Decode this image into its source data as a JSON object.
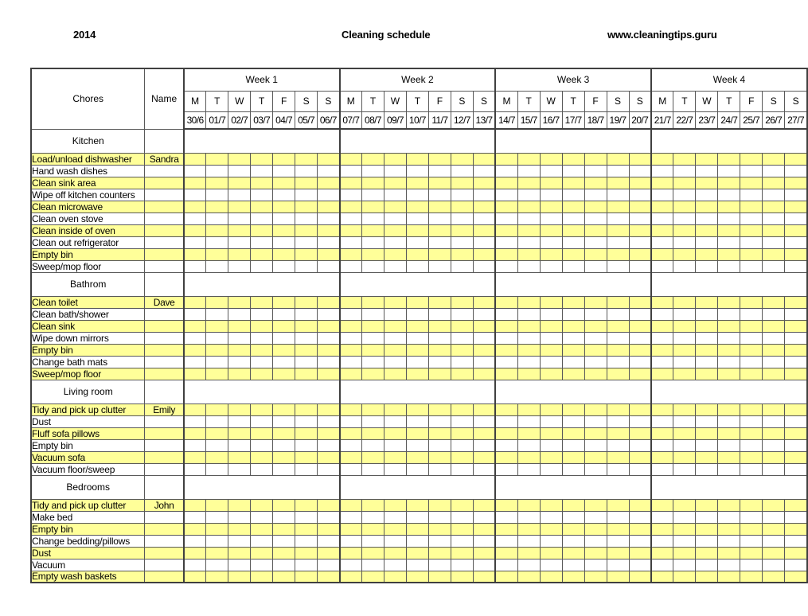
{
  "header": {
    "year": "2014",
    "title": "Cleaning schedule",
    "website": "www.cleaningtips.guru"
  },
  "table": {
    "col_chores": "Chores",
    "col_name": "Name",
    "weeks": [
      {
        "label": "Week 1",
        "days": [
          "M",
          "T",
          "W",
          "T",
          "F",
          "S",
          "S"
        ],
        "dates": [
          "30/6",
          "01/7",
          "02/7",
          "03/7",
          "04/7",
          "05/7",
          "06/7"
        ]
      },
      {
        "label": "Week 2",
        "days": [
          "M",
          "T",
          "W",
          "T",
          "F",
          "S",
          "S"
        ],
        "dates": [
          "07/7",
          "08/7",
          "09/7",
          "10/7",
          "11/7",
          "12/7",
          "13/7"
        ]
      },
      {
        "label": "Week 3",
        "days": [
          "M",
          "T",
          "W",
          "T",
          "F",
          "S",
          "S"
        ],
        "dates": [
          "14/7",
          "15/7",
          "16/7",
          "17/7",
          "18/7",
          "19/7",
          "20/7"
        ]
      },
      {
        "label": "Week 4",
        "days": [
          "M",
          "T",
          "W",
          "T",
          "F",
          "S",
          "S"
        ],
        "dates": [
          "21/7",
          "22/7",
          "23/7",
          "24/7",
          "25/7",
          "26/7",
          "27/7"
        ]
      }
    ],
    "sections": [
      {
        "title": "Kitchen",
        "rows": [
          {
            "chore": "Load/unload dishwasher",
            "name": "Sandra",
            "shade": "yellow"
          },
          {
            "chore": "Hand wash dishes",
            "name": "",
            "shade": "white"
          },
          {
            "chore": "Clean sink area",
            "name": "",
            "shade": "yellow"
          },
          {
            "chore": "Wipe off kitchen counters",
            "name": "",
            "shade": "white"
          },
          {
            "chore": "Clean microwave",
            "name": "",
            "shade": "yellow"
          },
          {
            "chore": "Clean oven stove",
            "name": "",
            "shade": "white"
          },
          {
            "chore": "Clean inside of oven",
            "name": "",
            "shade": "yellow"
          },
          {
            "chore": "Clean out refrigerator",
            "name": "",
            "shade": "white"
          },
          {
            "chore": "Empty bin",
            "name": "",
            "shade": "yellow"
          },
          {
            "chore": "Sweep/mop floor",
            "name": "",
            "shade": "white"
          }
        ]
      },
      {
        "title": "Bathrom",
        "rows": [
          {
            "chore": "Clean toilet",
            "name": "Dave",
            "shade": "yellow"
          },
          {
            "chore": "Clean bath/shower",
            "name": "",
            "shade": "white"
          },
          {
            "chore": "Clean sink",
            "name": "",
            "shade": "yellow"
          },
          {
            "chore": "Wipe down mirrors",
            "name": "",
            "shade": "white"
          },
          {
            "chore": "Empty bin",
            "name": "",
            "shade": "yellow"
          },
          {
            "chore": "Change bath mats",
            "name": "",
            "shade": "white"
          },
          {
            "chore": "Sweep/mop floor",
            "name": "",
            "shade": "yellow"
          }
        ]
      },
      {
        "title": "Living room",
        "rows": [
          {
            "chore": "Tidy and pick up clutter",
            "name": "Emily",
            "shade": "yellow"
          },
          {
            "chore": "Dust",
            "name": "",
            "shade": "white"
          },
          {
            "chore": "Fluff sofa pillows",
            "name": "",
            "shade": "yellow"
          },
          {
            "chore": "Empty bin",
            "name": "",
            "shade": "white"
          },
          {
            "chore": "Vacuum sofa",
            "name": "",
            "shade": "yellow"
          },
          {
            "chore": "Vacuum floor/sweep",
            "name": "",
            "shade": "white"
          }
        ]
      },
      {
        "title": "Bedrooms",
        "rows": [
          {
            "chore": "Tidy and pick up clutter",
            "name": "John",
            "shade": "yellow"
          },
          {
            "chore": "Make bed",
            "name": "",
            "shade": "white"
          },
          {
            "chore": "Empty bin",
            "name": "",
            "shade": "yellow"
          },
          {
            "chore": "Change bedding/pillows",
            "name": "",
            "shade": "white"
          },
          {
            "chore": "Dust",
            "name": "",
            "shade": "yellow"
          },
          {
            "chore": "Vacuum",
            "name": "",
            "shade": "white"
          },
          {
            "chore": "Empty wash baskets",
            "name": "",
            "shade": "yellow"
          }
        ]
      }
    ]
  },
  "colors": {
    "shade_yellow": "#ffff99",
    "shade_white": "#ffffff",
    "grid_line": "#595959",
    "grid_heavy": "#404040"
  }
}
